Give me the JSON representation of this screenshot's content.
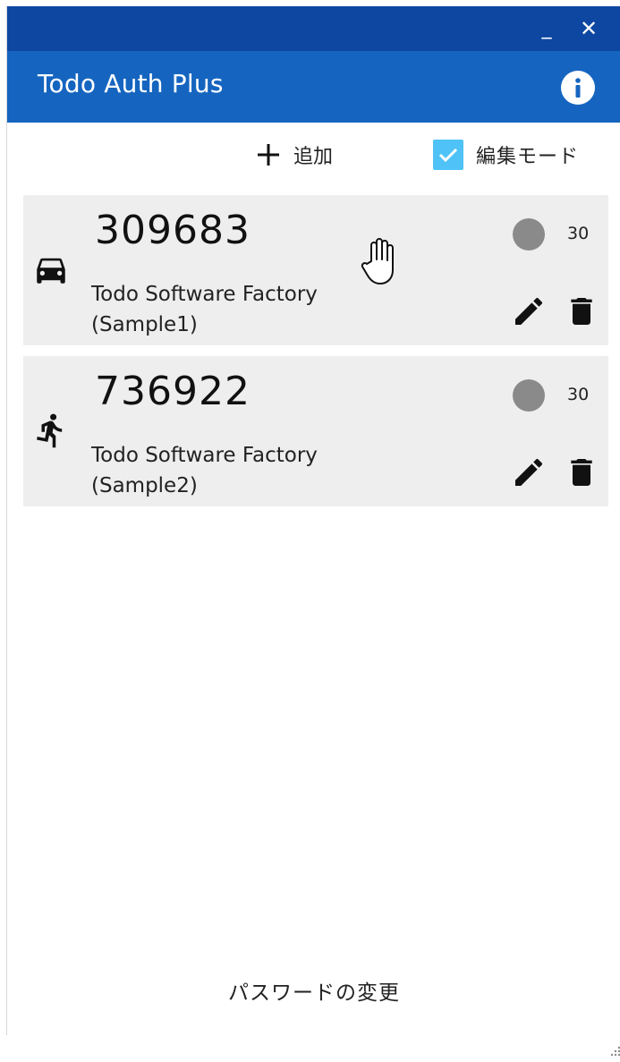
{
  "window": {
    "minimize_symbol": "_",
    "close_symbol": "✕"
  },
  "appbar": {
    "title": "Todo Auth Plus",
    "info_icon": "info-icon"
  },
  "toolbar": {
    "add_label": "追加",
    "edit_mode_label": "編集モード",
    "edit_mode_checked": true
  },
  "accounts": [
    {
      "icon": "car-icon",
      "code": "309683",
      "name_line1": "Todo Software Factory",
      "name_line2": "(Sample1)",
      "seconds": "30"
    },
    {
      "icon": "running-icon",
      "code": "736922",
      "name_line1": "Todo Software Factory",
      "name_line2": "(Sample2)",
      "seconds": "30"
    }
  ],
  "footer": {
    "change_password_label": "パスワードの変更"
  },
  "colors": {
    "titlebar": "#0d47a1",
    "appbar": "#1565c0",
    "checkbox": "#4fc3f7",
    "card_bg": "#eeeeee",
    "timer_dot": "#8a8a8a"
  }
}
